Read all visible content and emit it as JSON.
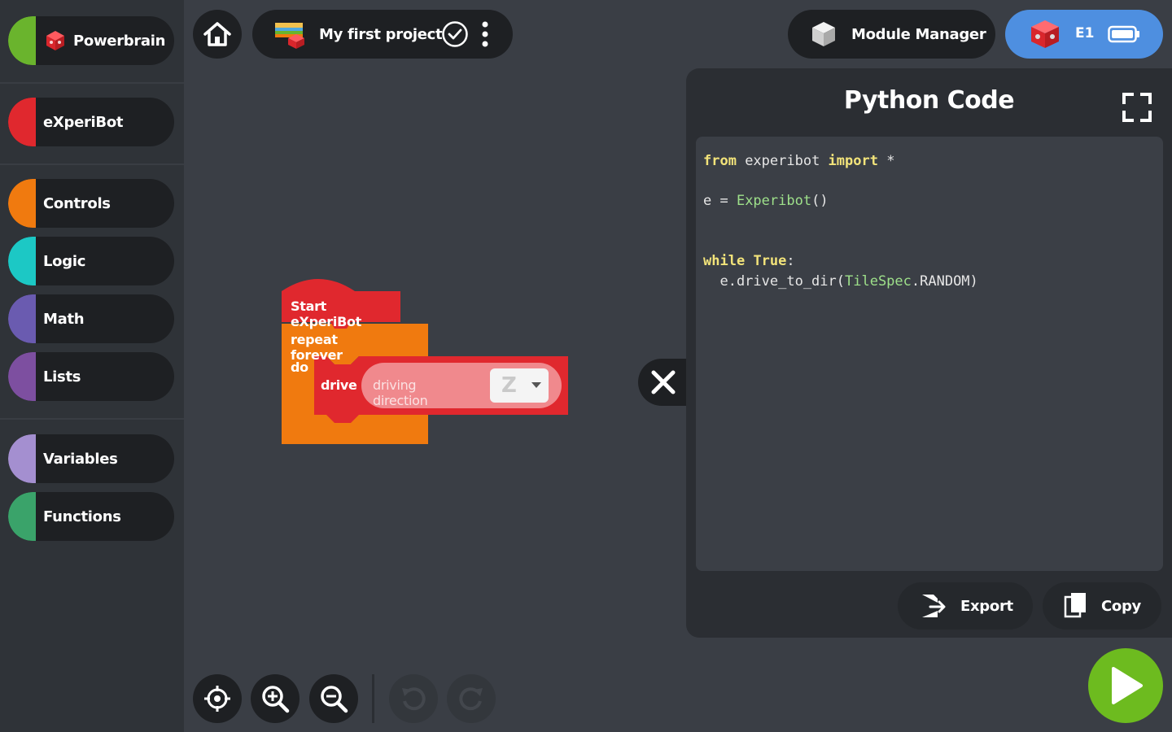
{
  "sidebar": {
    "items": [
      {
        "id": "powerbrain",
        "label": "Powerbrain",
        "color": "#6ab42d"
      },
      {
        "id": "experibot",
        "label": "eXperiBot",
        "color": "#e0282e"
      },
      {
        "id": "controls",
        "label": "Controls",
        "color": "#f07a0f"
      },
      {
        "id": "logic",
        "label": "Logic",
        "color": "#1cc8c5"
      },
      {
        "id": "math",
        "label": "Math",
        "color": "#6a5bb0"
      },
      {
        "id": "lists",
        "label": "Lists",
        "color": "#7d4fa0"
      },
      {
        "id": "variables",
        "label": "Variables",
        "color": "#a48fd0"
      },
      {
        "id": "functions",
        "label": "Functions",
        "color": "#3aa36a"
      }
    ]
  },
  "header": {
    "project_title": "My first project",
    "module_manager_label": "Module Manager",
    "device_label": "E1"
  },
  "workspace": {
    "blocks": {
      "start_label": "Start eXperiBot",
      "repeat_label": "repeat forever",
      "do_label": "do",
      "drive_label": "drive",
      "direction_label": "driving direction",
      "direction_value": "Z",
      "colors": {
        "start": "#e0282e",
        "repeat": "#f07a0f",
        "drive": "#e0282e"
      }
    }
  },
  "code_panel": {
    "title": "Python Code",
    "lines": [
      {
        "kw1": "from",
        "text1": " experibot ",
        "kw2": "import",
        "text2": " *"
      },
      {
        "text1": "e = ",
        "cls": "Experibot",
        "text2": "()"
      },
      {
        "kw1": "while",
        "text1": " ",
        "kw2": "True",
        "text2": ":"
      },
      {
        "text1": "  e.drive_to_dir(",
        "cls": "TileSpec",
        "text2": ".RANDOM)"
      }
    ],
    "export_label": "Export",
    "copy_label": "Copy"
  }
}
